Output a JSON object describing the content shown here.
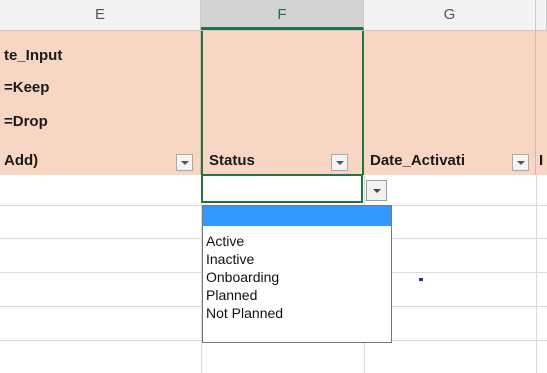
{
  "column_headers": [
    {
      "letter": "E",
      "selected": false
    },
    {
      "letter": "F",
      "selected": true
    },
    {
      "letter": "G",
      "selected": false
    }
  ],
  "header_row": {
    "col_e": {
      "lines": [
        "te_Input",
        "=Keep",
        "=Drop"
      ],
      "label": "Add)"
    },
    "col_f": {
      "label": "Status"
    },
    "col_g": {
      "label": "Date_Activati"
    },
    "col_h": {
      "label": "I"
    }
  },
  "dropdown": {
    "options": [
      "",
      "Active",
      "Inactive",
      "Onboarding",
      "Planned",
      "Not Planned"
    ],
    "highlighted_index": 0
  },
  "colors": {
    "header_fill": "#f7d7c4",
    "selection_border": "#217346",
    "highlight": "#3399ff"
  }
}
